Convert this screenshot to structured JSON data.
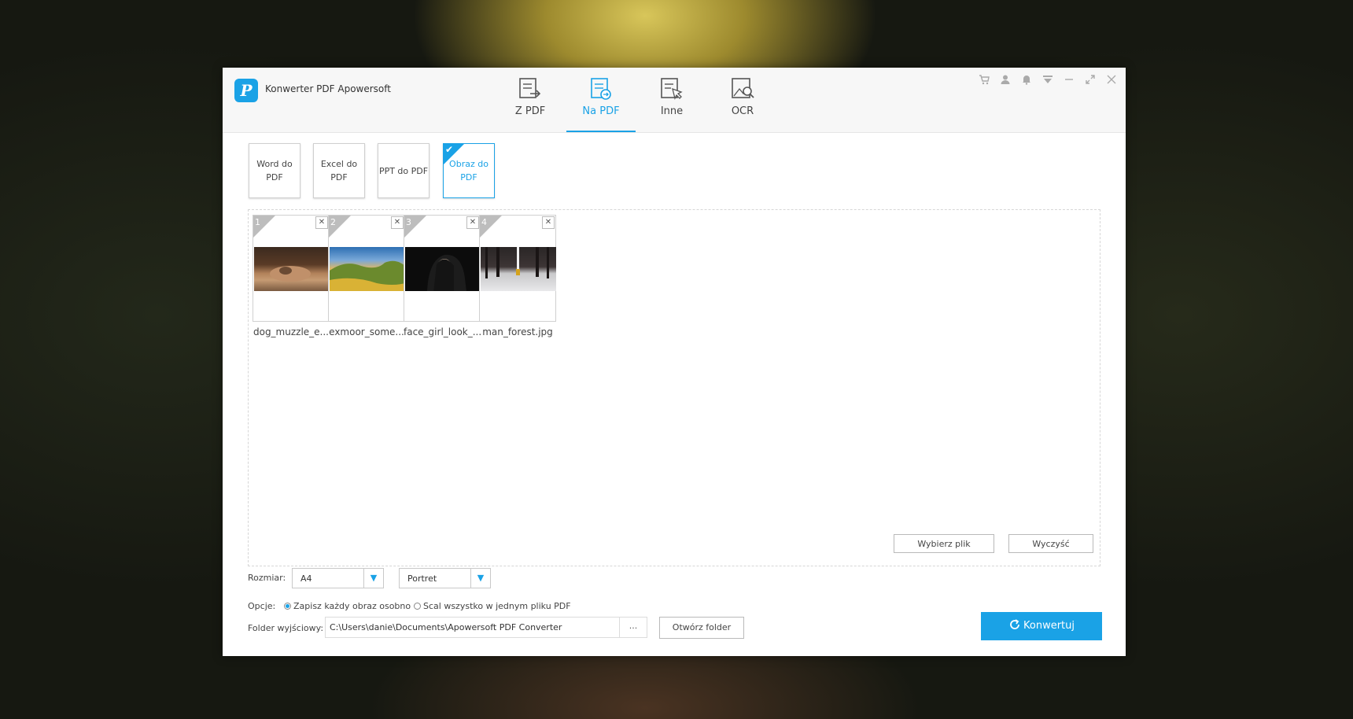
{
  "app": {
    "logo": "P",
    "title": "Konwerter PDF Apowersoft"
  },
  "tabs": [
    {
      "label": "Z PDF",
      "icon": "from-pdf-icon"
    },
    {
      "label": "Na PDF",
      "icon": "to-pdf-icon",
      "active": true
    },
    {
      "label": "Inne",
      "icon": "other-tools-icon"
    },
    {
      "label": "OCR",
      "icon": "ocr-icon"
    }
  ],
  "window_controls": [
    "cart-icon",
    "user-icon",
    "bell-icon",
    "menu-icon",
    "minimize-icon",
    "restore-icon",
    "close-icon"
  ],
  "modes": [
    {
      "label": "Word do PDF"
    },
    {
      "label": "Excel do PDF"
    },
    {
      "label": "PPT do PDF"
    },
    {
      "label": "Obraz do PDF",
      "selected": true
    }
  ],
  "files": [
    {
      "index": "1",
      "name": "dog_muzzle_e..."
    },
    {
      "index": "2",
      "name": "exmoor_some..."
    },
    {
      "index": "3",
      "name": "face_girl_look_..."
    },
    {
      "index": "4",
      "name": "man_forest.jpg"
    }
  ],
  "actions": {
    "choose_file": "Wybierz plik",
    "clear": "Wyczyść"
  },
  "settings": {
    "size_label": "Rozmiar:",
    "size_value": "A4",
    "orientation_value": "Portret",
    "options_label": "Opcje:",
    "option_separate": "Zapisz każdy obraz osobno",
    "option_merge": "Scal wszystko w jednym pliku PDF",
    "output_label": "Folder wyjściowy:",
    "output_path": "C:\\Users\\danie\\Documents\\Apowersoft PDF Converter",
    "browse": "...",
    "open_folder": "Otwórz folder"
  },
  "convert_label": "Konwertuj",
  "colors": {
    "accent": "#1aa2e6"
  }
}
